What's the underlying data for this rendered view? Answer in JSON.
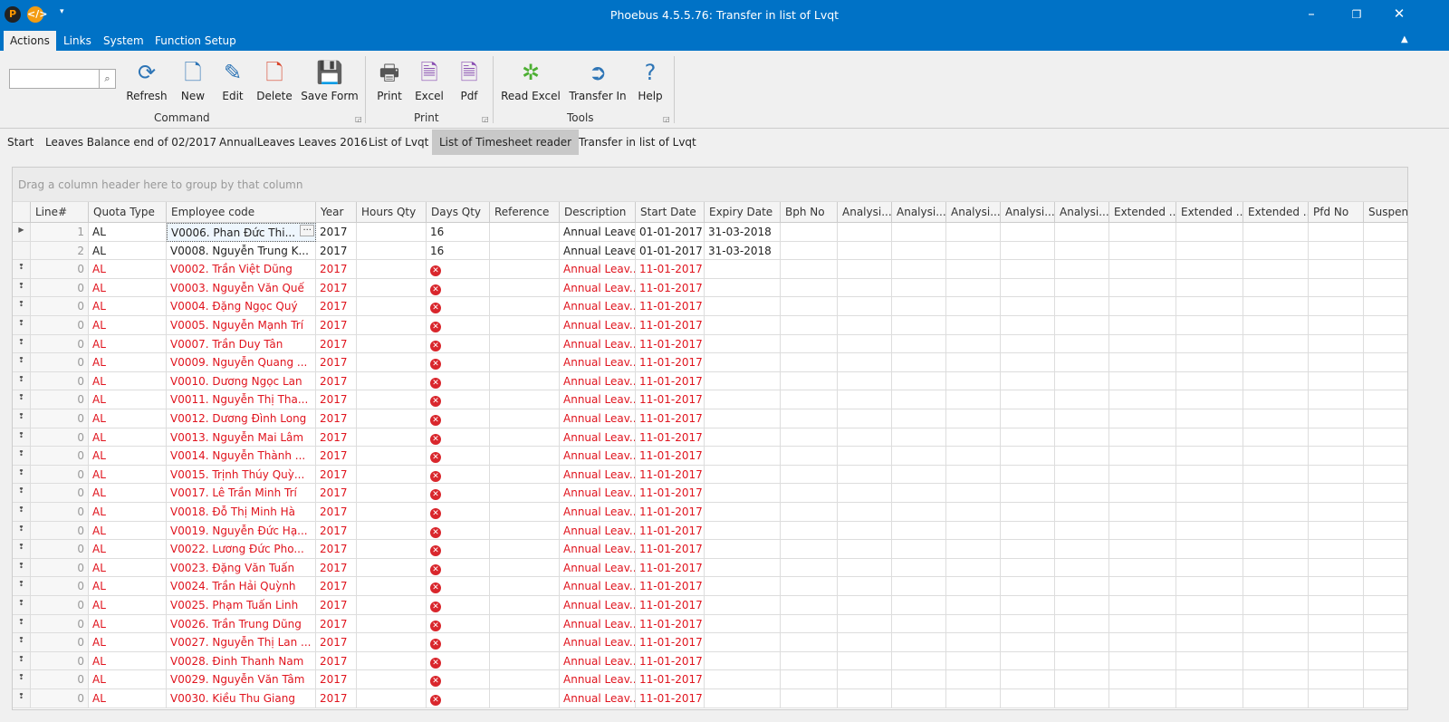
{
  "window": {
    "title": "Phoebus 4.5.5.76: Transfer in list of Lvqt",
    "minimize": "–",
    "restore": "❐",
    "close": "✕"
  },
  "menu": [
    "Actions",
    "Links",
    "System",
    "Function Setup"
  ],
  "ribbon": {
    "search": {
      "value": "",
      "placeholder": ""
    },
    "buttons": [
      {
        "label": "Refresh",
        "icon": "refresh-icon",
        "glyph": "⟳",
        "color": "#2e75b6"
      },
      {
        "label": "New",
        "icon": "new-document-icon",
        "glyph": "🗋",
        "color": "#2e75b6"
      },
      {
        "label": "Edit",
        "icon": "edit-icon",
        "glyph": "✎",
        "color": "#2e75b6"
      },
      {
        "label": "Delete",
        "icon": "delete-icon",
        "glyph": "🗋",
        "color": "#d9462c"
      },
      {
        "label": "Save Form",
        "icon": "save-icon",
        "glyph": "💾",
        "color": "#2e4a6b"
      },
      {
        "label": "Print",
        "icon": "printer-icon",
        "glyph": "🖶",
        "color": "#555"
      },
      {
        "label": "Excel",
        "icon": "excel-icon",
        "glyph": "🗎",
        "color": "#8a4fb2"
      },
      {
        "label": "Pdf",
        "icon": "pdf-icon",
        "glyph": "🗎",
        "color": "#8a4fb2"
      },
      {
        "label": "Read Excel",
        "icon": "read-excel-icon",
        "glyph": "✲",
        "color": "#4caf32"
      },
      {
        "label": "Transfer In",
        "icon": "transfer-in-icon",
        "glyph": "➲",
        "color": "#2e75b6"
      },
      {
        "label": "Help",
        "icon": "help-icon",
        "glyph": "?",
        "color": "#2e75b6"
      }
    ],
    "groups": [
      "Command",
      "Print",
      "Tools"
    ]
  },
  "tabs": [
    "Start",
    "Leaves Balance end of 02/2017",
    "AnnualLeaves Leaves 2016",
    "List of Lvqt",
    "List of Timesheet reader",
    "Transfer in list of Lvqt"
  ],
  "grid": {
    "group_hint": "Drag a column header here to group by that column",
    "columns": [
      "Line#",
      "Quota Type",
      "Employee code",
      "Year",
      "Hours Qty",
      "Days Qty",
      "Reference",
      "Description",
      "Start Date",
      "Expiry Date",
      "Bph No",
      "Analysi...",
      "Analysi...",
      "Analysi...",
      "Analysi...",
      "Analysi...",
      "Extended ...",
      "Extended ...",
      "Extended ...",
      "Pfd No",
      "Suspend"
    ],
    "rows": [
      {
        "line": "1",
        "quota": "AL",
        "employee": "V0006. Phan Đức  Thi...",
        "year": "2017",
        "days": "16",
        "description": "Annual Leave",
        "start": "01-01-2017",
        "expiry": "31-03-2018",
        "error": false,
        "current": true
      },
      {
        "line": "2",
        "quota": "AL",
        "employee": "V0008. Nguyễn Trung  K...",
        "year": "2017",
        "days": "16",
        "description": "Annual Leave",
        "start": "01-01-2017",
        "expiry": "31-03-2018",
        "error": false
      },
      {
        "line": "0",
        "quota": "AL",
        "employee": "V0002. Trần Việt  Dũng",
        "year": "2017",
        "description": "Annual Leav...",
        "start": "11-01-2017",
        "error": true
      },
      {
        "line": "0",
        "quota": "AL",
        "employee": "V0003. Nguyễn Văn  Quế",
        "year": "2017",
        "description": "Annual Leav...",
        "start": "11-01-2017",
        "error": true
      },
      {
        "line": "0",
        "quota": "AL",
        "employee": "V0004. Đặng Ngọc  Quý",
        "year": "2017",
        "description": "Annual Leav...",
        "start": "11-01-2017",
        "error": true
      },
      {
        "line": "0",
        "quota": "AL",
        "employee": "V0005. Nguyễn Mạnh  Trí",
        "year": "2017",
        "description": "Annual Leav...",
        "start": "11-01-2017",
        "error": true
      },
      {
        "line": "0",
        "quota": "AL",
        "employee": "V0007. Trần Duy  Tân",
        "year": "2017",
        "description": "Annual Leav...",
        "start": "11-01-2017",
        "error": true
      },
      {
        "line": "0",
        "quota": "AL",
        "employee": "V0009. Nguyễn Quang  ...",
        "year": "2017",
        "description": "Annual Leav...",
        "start": "11-01-2017",
        "error": true
      },
      {
        "line": "0",
        "quota": "AL",
        "employee": "V0010. Dương Ngọc  Lan",
        "year": "2017",
        "description": "Annual Leav...",
        "start": "11-01-2017",
        "error": true
      },
      {
        "line": "0",
        "quota": "AL",
        "employee": "V0011. Nguyễn Thị Tha...",
        "year": "2017",
        "description": "Annual Leav...",
        "start": "11-01-2017",
        "error": true
      },
      {
        "line": "0",
        "quota": "AL",
        "employee": "V0012. Dương Đình  Long",
        "year": "2017",
        "description": "Annual Leav...",
        "start": "11-01-2017",
        "error": true
      },
      {
        "line": "0",
        "quota": "AL",
        "employee": "V0013. Nguyễn Mai  Lâm",
        "year": "2017",
        "description": "Annual Leav...",
        "start": "11-01-2017",
        "error": true
      },
      {
        "line": "0",
        "quota": "AL",
        "employee": "V0014. Nguyễn Thành  ...",
        "year": "2017",
        "description": "Annual Leav...",
        "start": "11-01-2017",
        "error": true
      },
      {
        "line": "0",
        "quota": "AL",
        "employee": "V0015. Trịnh Thúy  Quỳ...",
        "year": "2017",
        "description": "Annual Leav...",
        "start": "11-01-2017",
        "error": true
      },
      {
        "line": "0",
        "quota": "AL",
        "employee": "V0017. Lê Trần Minh  Trí",
        "year": "2017",
        "description": "Annual Leav...",
        "start": "11-01-2017",
        "error": true
      },
      {
        "line": "0",
        "quota": "AL",
        "employee": "V0018. Đỗ Thị Minh  Hà",
        "year": "2017",
        "description": "Annual Leav...",
        "start": "11-01-2017",
        "error": true
      },
      {
        "line": "0",
        "quota": "AL",
        "employee": "V0019. Nguyễn Đức  Hạ...",
        "year": "2017",
        "description": "Annual Leav...",
        "start": "11-01-2017",
        "error": true
      },
      {
        "line": "0",
        "quota": "AL",
        "employee": "V0022. Lương Đức  Pho...",
        "year": "2017",
        "description": "Annual Leav...",
        "start": "11-01-2017",
        "error": true
      },
      {
        "line": "0",
        "quota": "AL",
        "employee": "V0023. Đặng Văn  Tuấn",
        "year": "2017",
        "description": "Annual Leav...",
        "start": "11-01-2017",
        "error": true
      },
      {
        "line": "0",
        "quota": "AL",
        "employee": "V0024. Trần Hải  Quỳnh",
        "year": "2017",
        "description": "Annual Leav...",
        "start": "11-01-2017",
        "error": true
      },
      {
        "line": "0",
        "quota": "AL",
        "employee": "V0025. Phạm Tuấn  Linh",
        "year": "2017",
        "description": "Annual Leav...",
        "start": "11-01-2017",
        "error": true
      },
      {
        "line": "0",
        "quota": "AL",
        "employee": "V0026. Trần Trung  Dũng",
        "year": "2017",
        "description": "Annual Leav...",
        "start": "11-01-2017",
        "error": true
      },
      {
        "line": "0",
        "quota": "AL",
        "employee": "V0027. Nguyễn Thị Lan ...",
        "year": "2017",
        "description": "Annual Leav...",
        "start": "11-01-2017",
        "error": true
      },
      {
        "line": "0",
        "quota": "AL",
        "employee": "V0028. Đinh Thanh  Nam",
        "year": "2017",
        "description": "Annual Leav...",
        "start": "11-01-2017",
        "error": true
      },
      {
        "line": "0",
        "quota": "AL",
        "employee": "V0029. Nguyễn Văn  Tâm",
        "year": "2017",
        "description": "Annual Leav...",
        "start": "11-01-2017",
        "error": true
      },
      {
        "line": "0",
        "quota": "AL",
        "employee": "V0030. Kiều Thu  Giang",
        "year": "2017",
        "description": "Annual Leav...",
        "start": "11-01-2017",
        "error": true
      }
    ]
  },
  "colors": {
    "titlebar": "#0072c6",
    "error": "#e0141e"
  }
}
